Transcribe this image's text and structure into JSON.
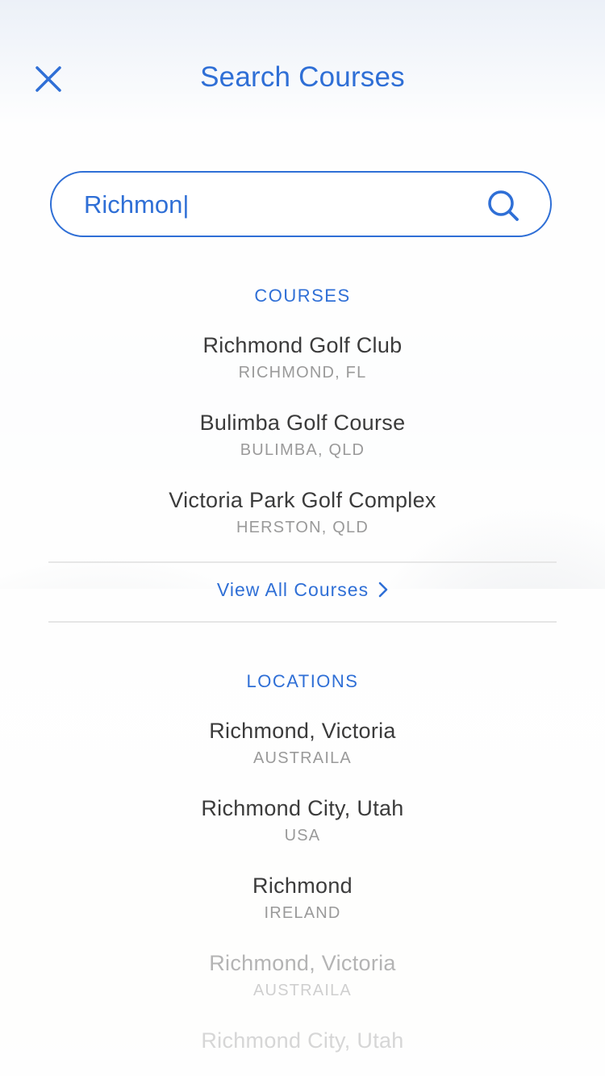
{
  "header": {
    "title": "Search Courses",
    "close_icon": "close-icon"
  },
  "search": {
    "value": "Richmon|",
    "icon": "search-icon"
  },
  "courses": {
    "heading": "COURSES",
    "items": [
      {
        "name": "Richmond Golf Club",
        "location": "RICHMOND, FL"
      },
      {
        "name": "Bulimba Golf Course",
        "location": "BULIMBA, QLD"
      },
      {
        "name": "Victoria Park Golf Complex",
        "location": "HERSTON, QLD"
      }
    ],
    "view_all_label": "View All Courses"
  },
  "locations": {
    "heading": "LOCATIONS",
    "items": [
      {
        "name": "Richmond, Victoria",
        "country": "AUSTRAILA"
      },
      {
        "name": "Richmond City, Utah",
        "country": "USA"
      },
      {
        "name": "Richmond",
        "country": "IRELAND"
      },
      {
        "name": "Richmond, Victoria",
        "country": "AUSTRAILA"
      },
      {
        "name": "Richmond City, Utah",
        "country": ""
      }
    ]
  },
  "colors": {
    "accent": "#2f6fd6",
    "primary_text": "#3b3b3b",
    "secondary_text": "#9a9a9a"
  }
}
